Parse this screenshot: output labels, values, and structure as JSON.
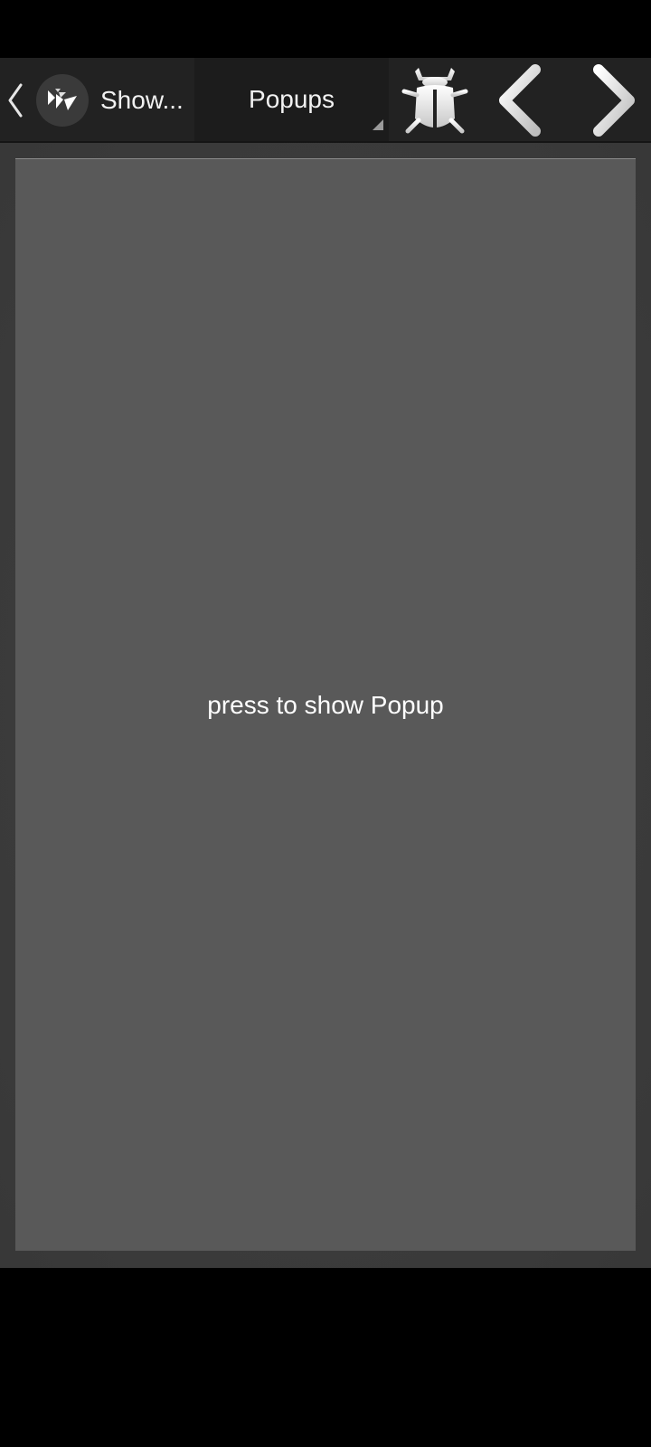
{
  "action_bar": {
    "app_title": "Show...",
    "spinner_label": "Popups",
    "icons": {
      "back": "chevron-left-icon",
      "app": "kivy-logo-icon",
      "bug": "bug-icon",
      "prev": "chevron-left-icon",
      "next": "chevron-right-icon"
    }
  },
  "content": {
    "button_label": "press to show Popup"
  },
  "colors": {
    "action_bar_bg": "#222222",
    "content_bg": "#383838",
    "button_bg": "#595959",
    "text": "#ffffff"
  }
}
